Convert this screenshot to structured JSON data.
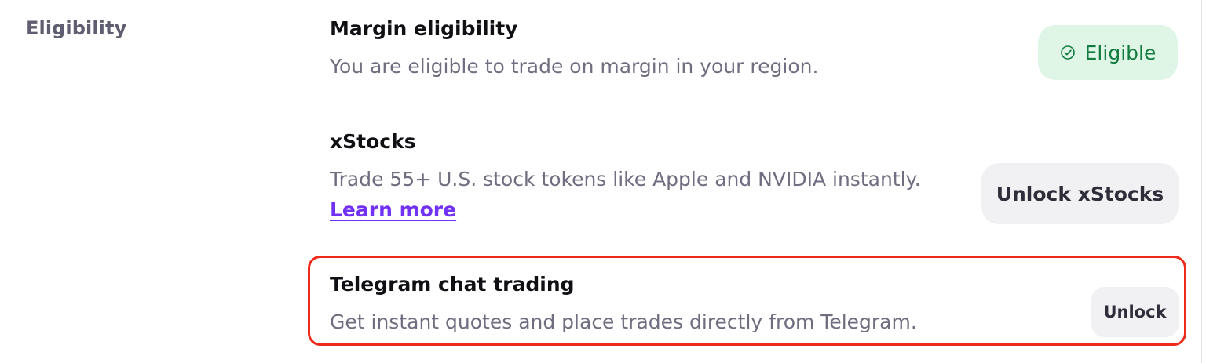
{
  "section": {
    "label": "Eligibility"
  },
  "rows": [
    {
      "title": "Margin eligibility",
      "description": "You are eligible to trade on margin in your region.",
      "status_label": "Eligible",
      "status_icon": "check-circle-icon"
    },
    {
      "title": "xStocks",
      "description": "Trade 55+ U.S. stock tokens like Apple and NVIDIA instantly.",
      "link_label": "Learn more",
      "button_label": "Unlock xStocks"
    },
    {
      "title": "Telegram chat trading",
      "description": "Get instant quotes and place trades directly from Telegram.",
      "button_label": "Unlock"
    }
  ],
  "colors": {
    "accent_link": "#7132f5",
    "eligible_bg": "#dff6e7",
    "eligible_text": "#137b3f",
    "highlight_border": "#ee2a1b",
    "button_bg": "#f1f1f4"
  }
}
